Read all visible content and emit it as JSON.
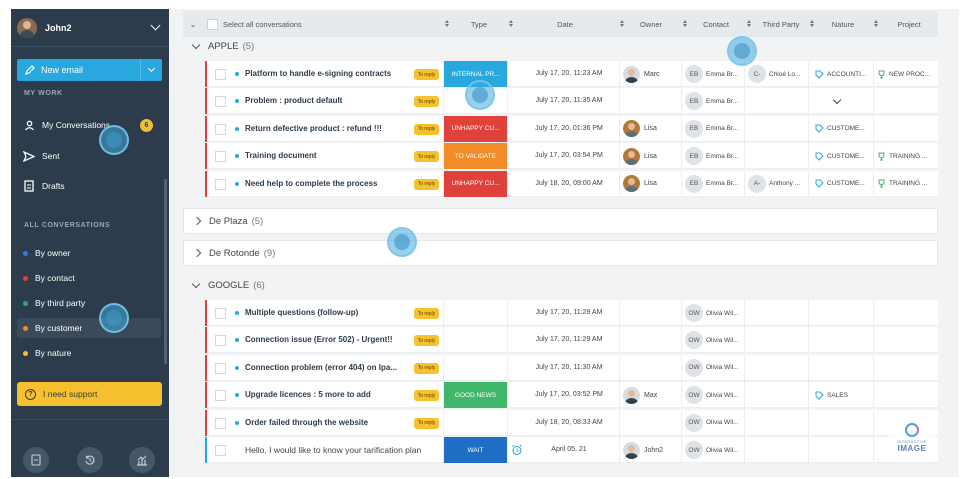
{
  "sidebar": {
    "user_name": "John2",
    "new_email_label": "New email",
    "my_work_heading": "MY WORK",
    "my_conversations": {
      "label": "My Conversations",
      "badge": "6"
    },
    "sent_label": "Sent",
    "drafts_label": "Drafts",
    "all_conversations_heading": "ALL CONVERSATIONS",
    "filters": [
      {
        "label": "By owner",
        "color": "#2f80d8"
      },
      {
        "label": "By contact",
        "color": "#e0413a"
      },
      {
        "label": "By third party",
        "color": "#27ae60"
      },
      {
        "label": "By customer",
        "color": "#f28c28"
      },
      {
        "label": "By nature",
        "color": "#f6c02e"
      }
    ],
    "support_label": "I need support",
    "footer_icons": [
      "document-icon",
      "history-icon",
      "stats-icon"
    ]
  },
  "header": {
    "select_all_label": "Select all conversations",
    "columns": [
      "Type",
      "Date",
      "Owner",
      "Contact",
      "Third Party",
      "Nature",
      "Project"
    ]
  },
  "groups": [
    {
      "name": "APPLE",
      "count": "(5)",
      "expanded": true,
      "rows": [
        {
          "subject": "Platform to handle e-signing contracts",
          "badge": "To reply",
          "type": "INTERNAL PR...",
          "type_color": "#29a8e0",
          "date": "July 17, 20, 11:23 AM",
          "owner": "Marc",
          "owner_photo": "man",
          "contact_initials": "EB",
          "contact": "Emma Br...",
          "third_initials": "C-",
          "third": "Chloé Lo...",
          "nature": "ACCOUNTI...",
          "project": "NEW PROC..."
        },
        {
          "subject": "Problem : product default",
          "badge": "To reply",
          "type": "",
          "type_color": "",
          "date": "July 17, 20, 11:35 AM",
          "owner": "",
          "owner_photo": "",
          "contact_initials": "EB",
          "contact": "Emma Br...",
          "third_initials": "",
          "third": "",
          "nature": "",
          "project": ""
        },
        {
          "subject": "Return defective product : refund !!!",
          "badge": "To reply",
          "type": "UNHAPPY CU...",
          "type_color": "#e0413a",
          "date": "July 17, 20, 01:36 PM",
          "owner": "Lisa",
          "owner_photo": "woman",
          "contact_initials": "EB",
          "contact": "Emma Br...",
          "third_initials": "",
          "third": "",
          "nature": "CUSTOME...",
          "project": ""
        },
        {
          "subject": "Training document",
          "badge": "To reply",
          "type": "TO VALIDATE",
          "type_color": "#f28c28",
          "date": "July 17, 20, 03:54 PM",
          "owner": "Lisa",
          "owner_photo": "woman",
          "contact_initials": "EB",
          "contact": "Emma Br...",
          "third_initials": "",
          "third": "",
          "nature": "CUSTOME...",
          "project": "TRAINING ..."
        },
        {
          "subject": "Need help to complete the process",
          "badge": "To reply",
          "type": "UNHAPPY CU...",
          "type_color": "#e0413a",
          "date": "July 18, 20, 09:00 AM",
          "owner": "Lisa",
          "owner_photo": "woman",
          "contact_initials": "EB",
          "contact": "Emma Br...",
          "third_initials": "A-",
          "third": "Anthony ...",
          "nature": "CUSTOME...",
          "project": "TRAINING ..."
        }
      ]
    },
    {
      "name": "De Plaza",
      "count": "(5)",
      "expanded": false,
      "rows": []
    },
    {
      "name": "De Rotonde",
      "count": "(9)",
      "expanded": false,
      "rows": []
    },
    {
      "name": "GOOGLE",
      "count": "(6)",
      "expanded": true,
      "rows": [
        {
          "subject": "Multiple questions (follow-up)",
          "badge": "To reply",
          "type": "",
          "type_color": "",
          "date": "July 17, 20, 11:29 AM",
          "owner": "",
          "owner_photo": "",
          "contact_initials": "OW",
          "contact": "Olivia Wil...",
          "third_initials": "",
          "third": "",
          "nature": "",
          "project": ""
        },
        {
          "subject": "Connection issue (Error 502) - Urgent!!",
          "badge": "To reply",
          "type": "",
          "type_color": "",
          "date": "July 17, 20, 11:29 AM",
          "owner": "",
          "owner_photo": "",
          "contact_initials": "OW",
          "contact": "Olivia Wil...",
          "third_initials": "",
          "third": "",
          "nature": "",
          "project": ""
        },
        {
          "subject": "Connection problem (error 404) on Ipa...",
          "badge": "To reply",
          "type": "",
          "type_color": "",
          "date": "July 17, 20, 11:30 AM",
          "owner": "",
          "owner_photo": "",
          "contact_initials": "OW",
          "contact": "Olivia Wil...",
          "third_initials": "",
          "third": "",
          "nature": "",
          "project": ""
        },
        {
          "subject": "Upgrade licences : 5 more to add",
          "badge": "To reply",
          "type": "GOOD NEWS",
          "type_color": "#3fb86b",
          "date": "July 17, 20, 03:52 PM",
          "owner": "Max",
          "owner_photo": "man",
          "contact_initials": "OW",
          "contact": "Olivia Wil...",
          "third_initials": "",
          "third": "",
          "nature": "SALES",
          "project": ""
        },
        {
          "subject": "Order failed through the website",
          "badge": "To reply",
          "type": "",
          "type_color": "",
          "date": "July 18, 20, 08:33 AM",
          "owner": "",
          "owner_photo": "",
          "contact_initials": "OW",
          "contact": "Olivia Wil...",
          "third_initials": "",
          "third": "",
          "nature": "",
          "project": ""
        },
        {
          "subject": "Hello, I would like to know your tarification plan",
          "badge": "",
          "type": "WAIT",
          "type_color": "#1f6fc5",
          "date": "April 05, 21",
          "owner": "John2",
          "owner_photo": "man",
          "contact_initials": "OW",
          "contact": "Olivia Wil...",
          "third_initials": "",
          "third": "",
          "nature": "",
          "project": ""
        }
      ]
    }
  ],
  "watermark": {
    "line1": "INTERACTIVE",
    "line2": "IMAGE"
  }
}
